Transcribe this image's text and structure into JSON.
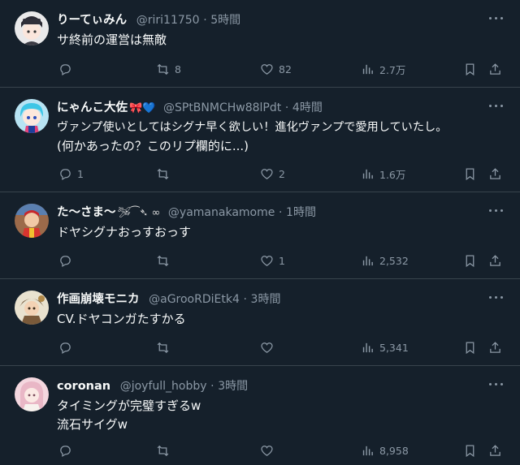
{
  "tweets": [
    {
      "name": "りーてぃみん",
      "emoji": "",
      "handle": "@riri11750",
      "time": "5時間",
      "lines": [
        "サ終前の運営は無敵"
      ],
      "replies": "",
      "retweets": "8",
      "likes": "82",
      "views": "2.7万",
      "avatar": "avatar-1"
    },
    {
      "name": "にゃんこ大佐",
      "emoji": "🎀💙",
      "handle": "@SPtBNMCHw88lPdt",
      "time": "4時間",
      "lines": [
        "ヴァンプ使いとしてはシグナ早く欲しい！進化ヴァンプで愛用していたし。",
        "(何かあったの？このリプ欄的に...)"
      ],
      "replies": "1",
      "retweets": "",
      "likes": "2",
      "views": "1.6万",
      "avatar": "avatar-2"
    },
    {
      "name": "た〜さま〜",
      "emoji": "🛩︎⁀➴ ∞",
      "handle": "@yamanakamome",
      "time": "1時間",
      "lines": [
        "ドヤシグナおっすおっす"
      ],
      "replies": "",
      "retweets": "",
      "likes": "1",
      "views": "2,532",
      "avatar": "avatar-3"
    },
    {
      "name": "作画崩壊モニカ",
      "emoji": "",
      "handle": "@aGrooRDiEtk4",
      "time": "3時間",
      "lines": [
        "CV.ドヤコンガたすかる"
      ],
      "replies": "",
      "retweets": "",
      "likes": "",
      "views": "5,341",
      "avatar": "avatar-4"
    },
    {
      "name": "coronan",
      "emoji": "",
      "handle": "@joyfull_hobby",
      "time": "3時間",
      "lines": [
        "タイミングが完璧すぎるw",
        "流石サイグw"
      ],
      "replies": "",
      "retweets": "",
      "likes": "",
      "views": "8,958",
      "avatar": "avatar-5"
    }
  ],
  "separator": "·",
  "colors": {
    "background": "#15202b",
    "text": "#f7f9f9",
    "muted": "#8b98a5",
    "border": "#38444d"
  },
  "icons": [
    "reply-icon",
    "retweet-icon",
    "like-icon",
    "views-icon",
    "bookmark-icon",
    "share-icon",
    "more-icon"
  ]
}
